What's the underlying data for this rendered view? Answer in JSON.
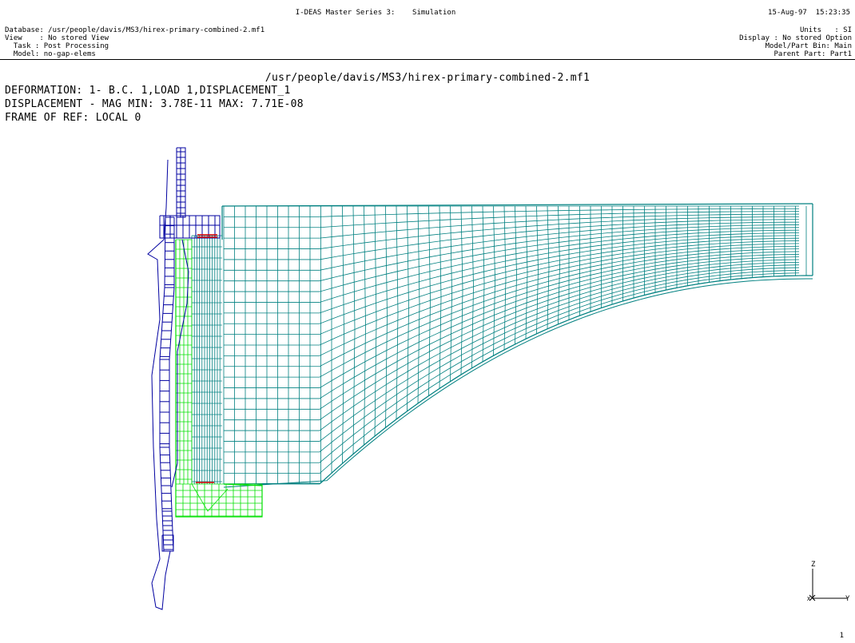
{
  "header": {
    "title": "I-DEAS Master Series 3:    Simulation",
    "datetime": "15-Aug-97  15:23:35",
    "left_lines": [
      "Database: /usr/people/davis/MS3/hirex-primary-combined-2.mf1",
      "View    : No stored View",
      "  Task : Post Processing",
      "  Model: no-gap-elems"
    ],
    "right_lines": [
      "Units   : SI",
      "Display : No stored Option",
      "Model/Part Bin: Main",
      "Parent Part: Part1"
    ]
  },
  "viewport": {
    "file_path": "/usr/people/davis/MS3/hirex-primary-combined-2.mf1",
    "info_lines": [
      "DEFORMATION: 1- B.C. 1,LOAD 1,DISPLACEMENT_1",
      "DISPLACEMENT - MAG MIN: 3.78E-11 MAX: 7.71E-08",
      "FRAME OF REF: LOCAL 0"
    ],
    "triad": {
      "z_label": "Z",
      "x_label": "X",
      "y_label": "Y"
    },
    "page_number": "1"
  },
  "colors": {
    "mesh_teal": "#008080",
    "mesh_green": "#00e000",
    "mesh_blue": "#0000a0",
    "constraint_red": "#e00000"
  }
}
